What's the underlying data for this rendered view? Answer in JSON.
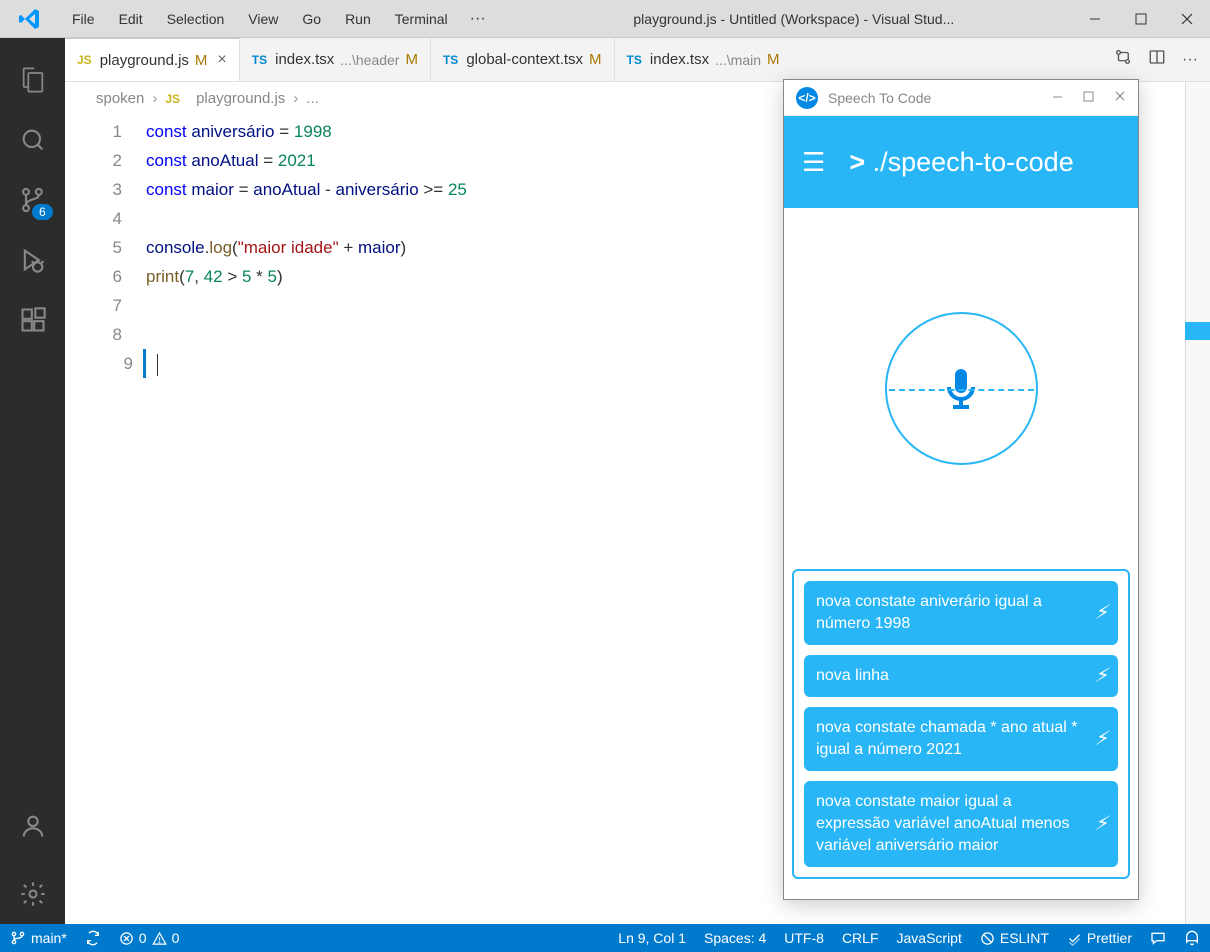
{
  "menubar": {
    "file": "File",
    "edit": "Edit",
    "selection": "Selection",
    "view": "View",
    "go": "Go",
    "run": "Run",
    "terminal": "Terminal"
  },
  "window_title": "playground.js - Untitled (Workspace) - Visual Stud...",
  "tabs": {
    "t0": {
      "label": "playground.js",
      "mod": "M"
    },
    "t1": {
      "label": "index.tsx",
      "path": "...\\header",
      "mod": "M"
    },
    "t2": {
      "label": "global-context.tsx",
      "mod": "M"
    },
    "t3": {
      "label": "index.tsx",
      "path": "...\\main",
      "mod": "M"
    }
  },
  "breadcrumb": {
    "root": "spoken",
    "file": "playground.js",
    "more": "..."
  },
  "activity": {
    "scm_badge": "6"
  },
  "code": {
    "l1_kw": "const",
    "l1_var": " aniversário ",
    "l1_eq": "= ",
    "l1_num": "1998",
    "l2_kw": "const",
    "l2_var": " anoAtual ",
    "l2_eq": "= ",
    "l2_num": "2021",
    "l3_kw": "const",
    "l3_var": " maior ",
    "l3_eq": "= ",
    "l3_v2": "anoAtual",
    "l3_op": " - ",
    "l3_v3": "aniversário",
    "l3_op2": " >= ",
    "l3_num": "25",
    "l5_obj": "console",
    "l5_dot": ".",
    "l5_fn": "log",
    "l5_p1": "(",
    "l5_str": "\"maior idade\"",
    "l5_op": " + ",
    "l5_var": "maior",
    "l5_p2": ")",
    "l6_fn": "print",
    "l6_p1": "(",
    "l6_n1": "7",
    "l6_c": ", ",
    "l6_n2": "42",
    "l6_op": " > ",
    "l6_n3": "5",
    "l6_op2": " * ",
    "l6_n4": "5",
    "l6_p2": ")",
    "ln1": "1",
    "ln2": "2",
    "ln3": "3",
    "ln4": "4",
    "ln5": "5",
    "ln6": "6",
    "ln7": "7",
    "ln8": "8",
    "ln9": "9"
  },
  "statusbar": {
    "branch": "main*",
    "errors": "0",
    "warnings": "0",
    "line_col": "Ln 9, Col 1",
    "spaces": "Spaces: 4",
    "encoding": "UTF-8",
    "eol": "CRLF",
    "language": "JavaScript",
    "eslint": "ESLINT",
    "prettier": "Prettier"
  },
  "speech": {
    "title": "Speech To Code",
    "header": "./speech-to-code",
    "commands": {
      "c0": "nova constate aniverário igual a número 1998",
      "c1": "nova linha",
      "c2": "nova constate chamada * ano atual * igual a número 2021",
      "c3": "nova constate maior igual a expressão variável anoAtual menos variável aniversário maior"
    }
  }
}
